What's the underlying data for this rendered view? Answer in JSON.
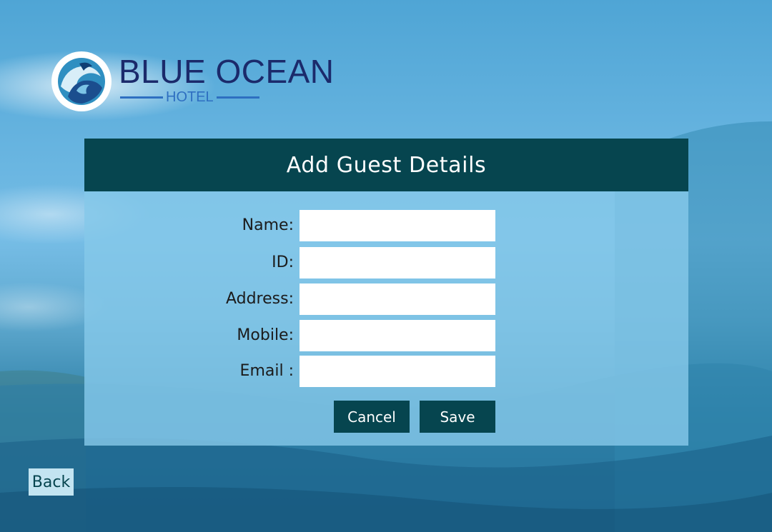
{
  "brand": {
    "name": "BLUE OCEAN",
    "subtitle": "HOTEL",
    "logo_icon": "wave-logo-icon"
  },
  "form": {
    "title": "Add Guest Details",
    "fields": [
      {
        "label": "Name:",
        "value": "",
        "placeholder": ""
      },
      {
        "label": "ID:",
        "value": "",
        "placeholder": ""
      },
      {
        "label": "Address:",
        "value": "",
        "placeholder": ""
      },
      {
        "label": "Mobile:",
        "value": "",
        "placeholder": ""
      },
      {
        "label": "Email :",
        "value": "",
        "placeholder": ""
      }
    ],
    "cancel_label": "Cancel",
    "save_label": "Save"
  },
  "nav": {
    "back_label": "Back"
  },
  "colors": {
    "header": "#06454f",
    "brand_text": "#1b2a6b",
    "brand_accent": "#2e6fc1",
    "panel": "#85c8e9",
    "back_button": "#c3e4f1"
  }
}
